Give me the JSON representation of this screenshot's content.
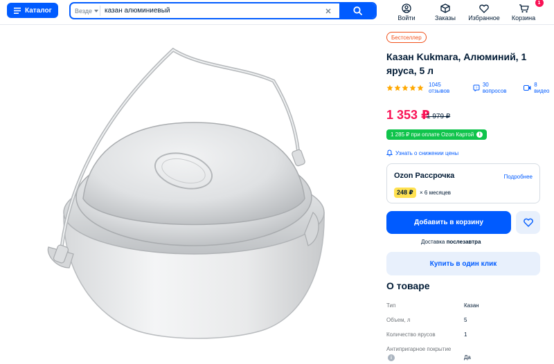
{
  "header": {
    "catalog_label": "Каталог",
    "search": {
      "scope": "Везде",
      "value": "казан алюминиевый"
    },
    "nav": [
      {
        "label": "Войти",
        "icon": "user-icon"
      },
      {
        "label": "Заказы",
        "icon": "box-icon"
      },
      {
        "label": "Избранное",
        "icon": "heart-icon"
      },
      {
        "label": "Корзина",
        "icon": "cart-icon",
        "badge": "1"
      }
    ]
  },
  "product": {
    "badge": "Бестселлер",
    "title": "Казан Kukmara, Алюминий, 1 яруса, 5 л",
    "rating_stars": 5,
    "reviews": "1045 отзывов",
    "questions": "30 вопросов",
    "videos": "8 видео",
    "price": "1 353 ₽",
    "old_price": "1 979 ₽",
    "card_price": "1 285 ₽ при оплате Ozon Картой",
    "notify": "Узнать о снижении цены",
    "installment": {
      "title": "Ozon Рассрочка",
      "more": "Подробнее",
      "amount": "248 ₽",
      "months": "× 6 месяцев"
    },
    "add_to_cart": "Добавить в корзину",
    "delivery_prefix": "Доставка",
    "delivery_day": "послезавтра",
    "buy_one_click": "Купить в один клик",
    "about_title": "О товаре",
    "specs": [
      {
        "key": "Тип",
        "value": "Казан"
      },
      {
        "key": "Объем, л",
        "value": "5"
      },
      {
        "key": "Количество ярусов",
        "value": "1"
      },
      {
        "key": "Антипригарное покрытие",
        "value": "Да"
      }
    ]
  },
  "colors": {
    "brand": "#005bff",
    "price": "#f91155",
    "ozon_card": "#10c44c",
    "star": "#ffa800"
  }
}
